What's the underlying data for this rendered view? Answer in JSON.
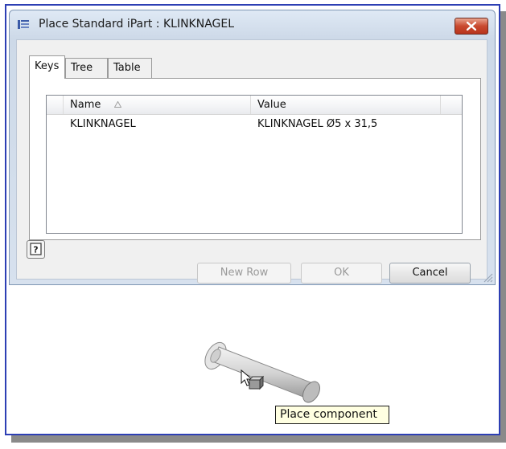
{
  "dialog": {
    "title": "Place Standard iPart : KLINKNAGEL",
    "close_icon": "close-x-icon"
  },
  "tabs": [
    {
      "label": "Keys",
      "active": true
    },
    {
      "label": "Tree",
      "active": false
    },
    {
      "label": "Table",
      "active": false
    }
  ],
  "table": {
    "columns": [
      "Name",
      "Value"
    ],
    "rows": [
      {
        "name": "KLINKNAGEL",
        "value": "KLINKNAGEL Ø5 x 31,5"
      }
    ]
  },
  "buttons": {
    "new_row": "New Row",
    "ok": "OK",
    "cancel": "Cancel"
  },
  "tooltip": {
    "text": "Place component"
  },
  "colors": {
    "frame_border": "#2d3fb4",
    "close_button": "#c9492f",
    "tooltip_bg": "#ffffe1"
  }
}
